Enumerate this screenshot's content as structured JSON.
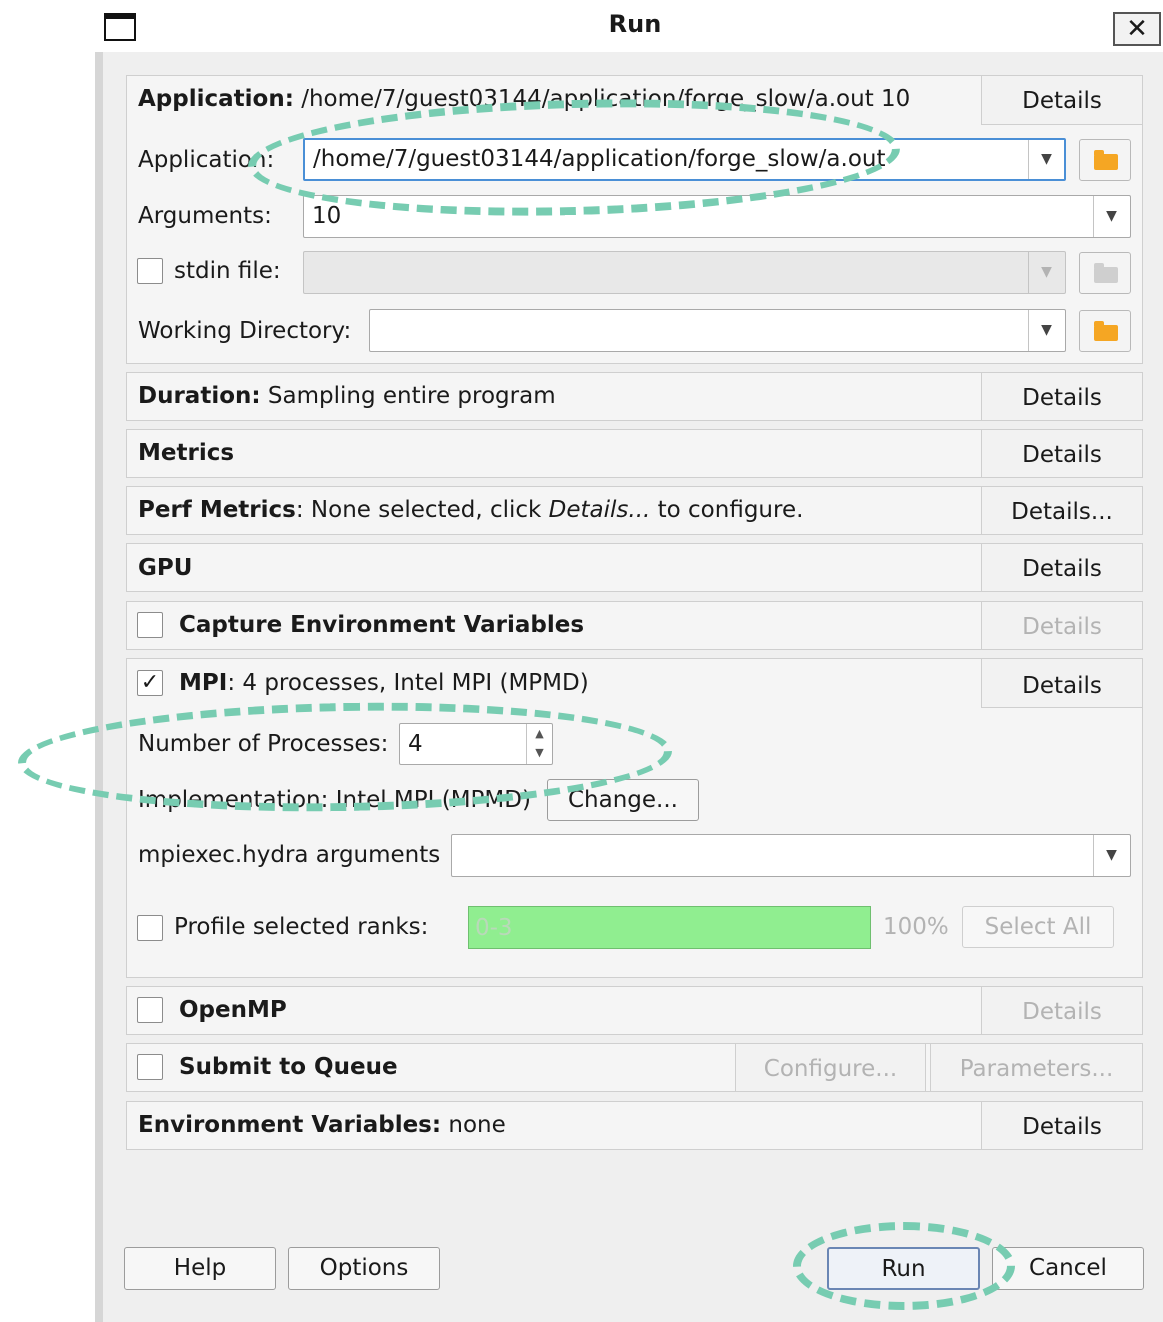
{
  "window": {
    "title": "Run",
    "close_icon": "✕"
  },
  "application": {
    "header_label": "Application:",
    "header_value": "/home/7/guest03144/application/forge_slow/a.out 10",
    "details_label": "Details",
    "app_label": "Application:",
    "app_value": "/home/7/guest03144/application/forge_slow/a.out",
    "args_label": "Arguments:",
    "args_value": "10",
    "stdin_label": "stdin file:",
    "stdin_value": "",
    "workdir_label": "Working Directory:",
    "workdir_value": ""
  },
  "duration": {
    "label": "Duration:",
    "value": "Sampling entire program",
    "details_label": "Details"
  },
  "metrics": {
    "label": "Metrics",
    "details_label": "Details"
  },
  "perf_metrics": {
    "label": "Perf Metrics",
    "value_prefix": ": None selected, click ",
    "value_italic": "Details...",
    "value_suffix": " to configure.",
    "details_label": "Details..."
  },
  "gpu": {
    "label": "GPU",
    "details_label": "Details"
  },
  "capture_env": {
    "label": "Capture Environment Variables",
    "checked": false,
    "details_label": "Details"
  },
  "mpi": {
    "checked": true,
    "check_glyph": "✓",
    "label": "MPI",
    "value": ": 4 processes, Intel MPI (MPMD)",
    "details_label": "Details",
    "nprocs_label": "Number of Processes:",
    "nprocs_value": "4",
    "impl_label": "Implementation:",
    "impl_value": "Intel MPI (MPMD)",
    "change_label": "Change...",
    "hydra_label": "mpiexec.hydra arguments",
    "hydra_value": "",
    "profile_label": "Profile selected ranks:",
    "ranks_value": "0-3",
    "ranks_percent": "100%",
    "select_all_label": "Select All"
  },
  "openmp": {
    "label": "OpenMP",
    "checked": false,
    "details_label": "Details"
  },
  "queue": {
    "label": "Submit to Queue",
    "checked": false,
    "configure_label": "Configure...",
    "parameters_label": "Parameters..."
  },
  "env_vars": {
    "label": "Environment Variables:",
    "value": "none",
    "details_label": "Details"
  },
  "footer": {
    "help_label": "Help",
    "options_label": "Options",
    "run_label": "Run",
    "cancel_label": "Cancel"
  },
  "colors": {
    "ranks_fill": "#90ee90",
    "accent_ring": "#77ccb1",
    "focus": "#4a8fd6"
  }
}
